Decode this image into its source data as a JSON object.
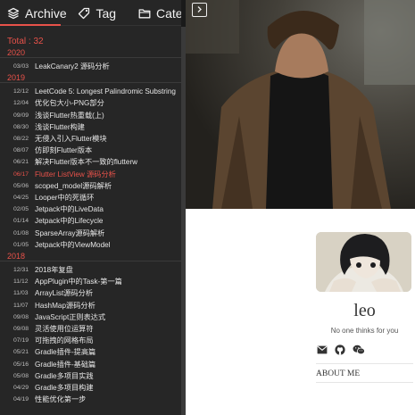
{
  "tabs": [
    {
      "label": "Archive",
      "icon": "layers-icon"
    },
    {
      "label": "Tag",
      "icon": "tag-icon"
    },
    {
      "label": "Cate",
      "icon": "folder-icon"
    }
  ],
  "total_label": "Total : 32",
  "years": [
    {
      "year": "2020",
      "posts": [
        {
          "date": "03/03",
          "title": "LeakCanary2 源码分析"
        }
      ]
    },
    {
      "year": "2019",
      "posts": [
        {
          "date": "12/12",
          "title": "LeetCode 5: Longest Palindromic Substring"
        },
        {
          "date": "12/04",
          "title": "优化包大小-PNG部分"
        },
        {
          "date": "09/09",
          "title": "浅谈Flutter热重载(上)"
        },
        {
          "date": "08/30",
          "title": "浅谈Flutter构建"
        },
        {
          "date": "08/22",
          "title": "无侵入引入Flutter模块"
        },
        {
          "date": "08/07",
          "title": "仿即刻Flutter版本"
        },
        {
          "date": "06/21",
          "title": "解决Flutter版本不一致的flutterw"
        },
        {
          "date": "06/17",
          "title": "Flutter ListView 源码分析"
        },
        {
          "date": "05/06",
          "title": "scoped_model源码解析"
        },
        {
          "date": "04/25",
          "title": "Looper中的死循环"
        },
        {
          "date": "02/05",
          "title": "Jetpack中的LiveData"
        },
        {
          "date": "01/14",
          "title": "Jetpack中的Lifecycle"
        },
        {
          "date": "01/08",
          "title": "SparseArray源码解析"
        },
        {
          "date": "01/05",
          "title": "Jetpack中的ViewModel"
        }
      ]
    },
    {
      "year": "2018",
      "posts": [
        {
          "date": "12/31",
          "title": "2018年复盘"
        },
        {
          "date": "11/12",
          "title": "AppPlugin中的Task-第一篇"
        },
        {
          "date": "11/03",
          "title": "ArrayList源码分析"
        },
        {
          "date": "11/07",
          "title": "HashMap源码分析"
        },
        {
          "date": "09/08",
          "title": "JavaScript正则表达式"
        },
        {
          "date": "09/08",
          "title": "灵活使用位运算符"
        },
        {
          "date": "07/19",
          "title": "可拖拽的网格布局"
        },
        {
          "date": "05/21",
          "title": "Gradle插件-提高篇"
        },
        {
          "date": "05/16",
          "title": "Gradle插件-基础篇"
        },
        {
          "date": "05/08",
          "title": "Gradle多项目实践"
        },
        {
          "date": "04/29",
          "title": "Gradle多项目构建"
        },
        {
          "date": "04/19",
          "title": "性能优化第一步"
        }
      ]
    }
  ],
  "active_post_date": "06/17",
  "profile": {
    "name": "leo",
    "tagline": "No one thinks for you",
    "social_icons": [
      "mail-icon",
      "github-icon",
      "wechat-icon"
    ],
    "about_label": "ABOUT ME"
  },
  "colors": {
    "accent": "#e8524a",
    "sidebar_bg": "#262626"
  }
}
